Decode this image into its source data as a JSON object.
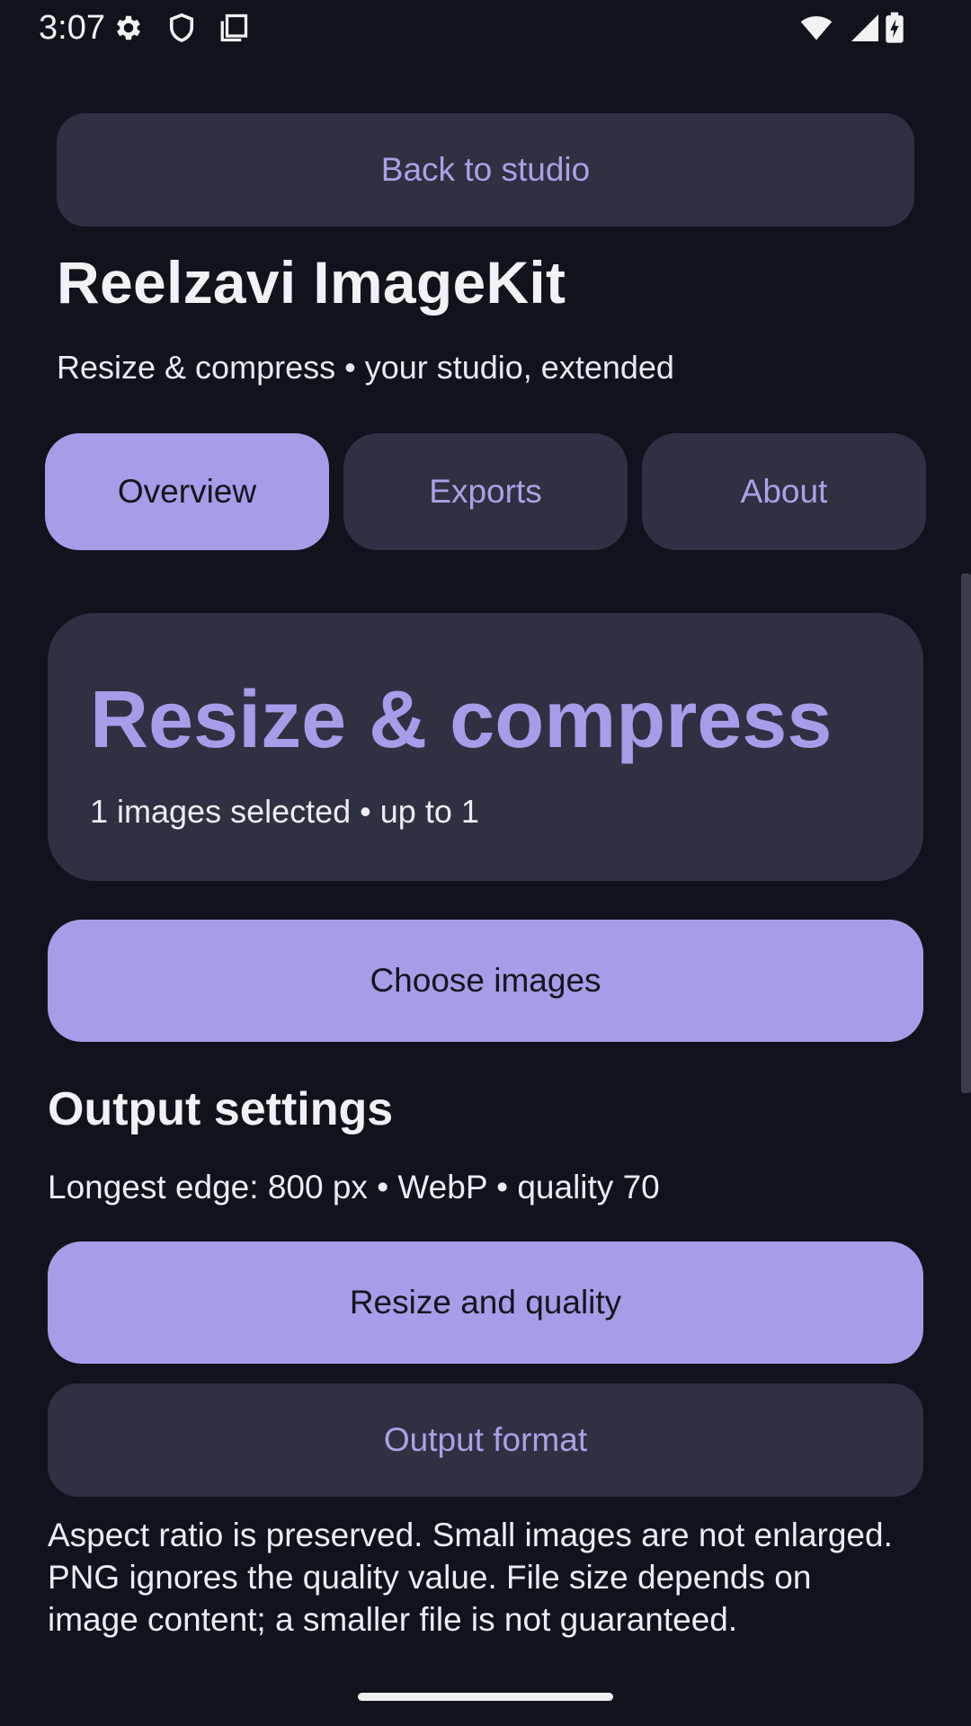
{
  "status_bar": {
    "time": "3:07",
    "left_icons": [
      "gear-icon",
      "shield-icon",
      "copy-icon"
    ],
    "right_icons": [
      "wifi-icon",
      "signal-icon",
      "battery-charging-icon"
    ]
  },
  "back_button": {
    "label": "Back to studio"
  },
  "header": {
    "title": "Reelzavi ImageKit",
    "subtitle": "Resize & compress • your studio, extended"
  },
  "tabs": [
    {
      "label": "Overview",
      "selected": true
    },
    {
      "label": "Exports",
      "selected": false
    },
    {
      "label": "About",
      "selected": false
    }
  ],
  "hero": {
    "title": "Resize & compress",
    "subtitle": "1 images selected • up to 1"
  },
  "choose_button": {
    "label": "Choose images"
  },
  "output_settings": {
    "title": "Output settings",
    "summary": "Longest edge: 800 px • WebP • quality 70",
    "resize_button": "Resize and quality",
    "format_button": "Output format",
    "note": "Aspect ratio is preserved. Small images are not enlarged. PNG ignores the quality value. File size depends on image content; a smaller file is not guaranteed."
  },
  "colors": {
    "background": "#10131b",
    "surface": "#2d3142",
    "accent": "#a69de9",
    "on_accent": "#15151c"
  }
}
